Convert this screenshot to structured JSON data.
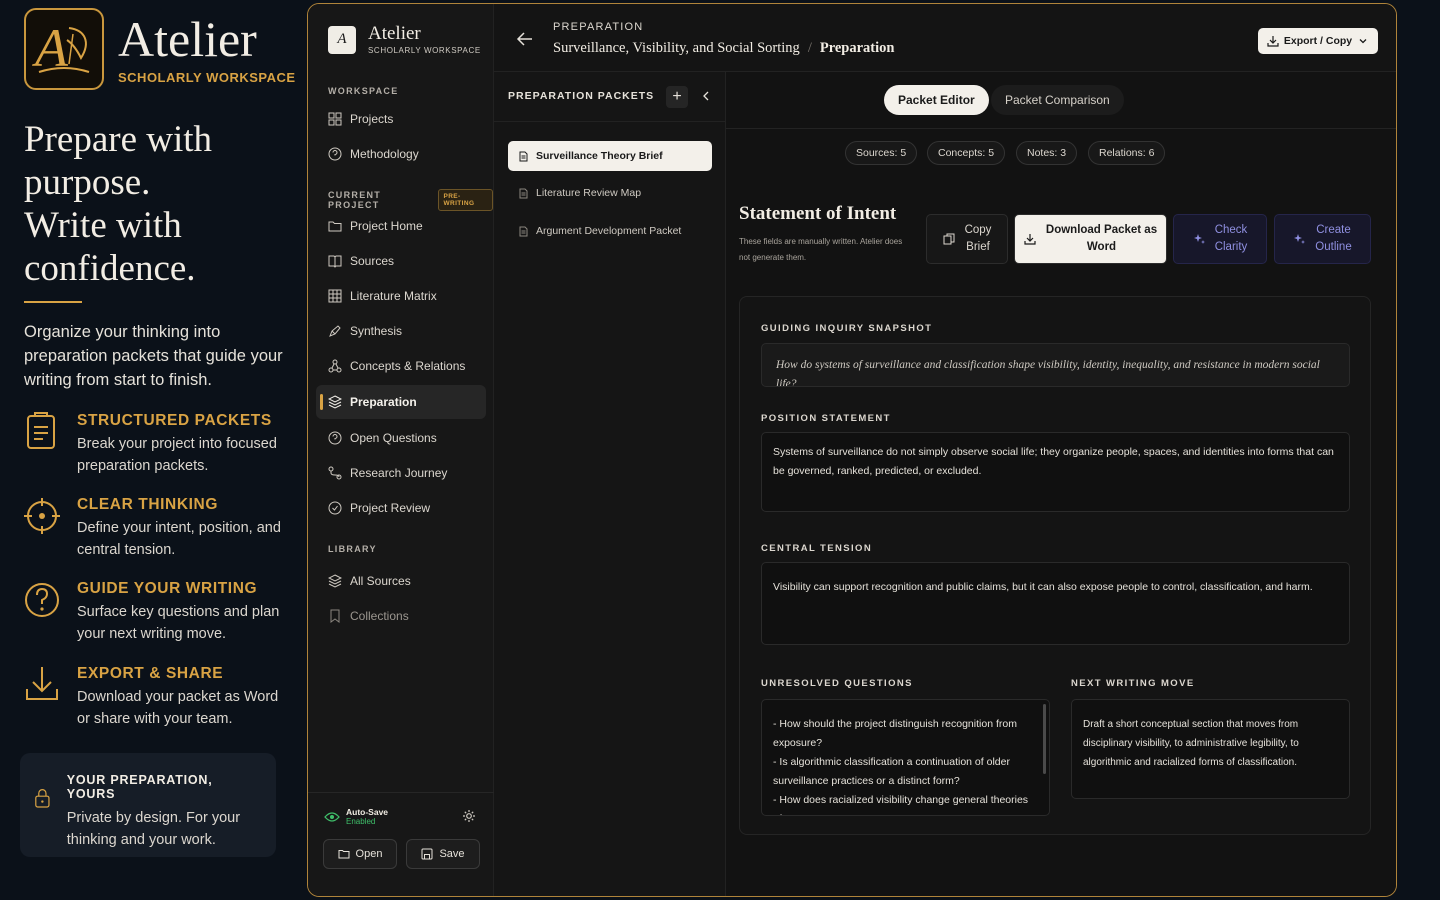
{
  "promo": {
    "brand_name": "Atelier",
    "brand_sub": "SCHOLARLY WORKSPACE",
    "headline": [
      "Prepare with",
      "purpose.",
      "Write with",
      "confidence."
    ],
    "intro": "Organize your thinking into preparation packets that guide your writing from start to finish.",
    "features": [
      {
        "icon": "document-icon",
        "title": "STRUCTURED PACKETS",
        "desc": "Break your project into focused preparation packets."
      },
      {
        "icon": "target-icon",
        "title": "CLEAR THINKING",
        "desc": "Define your intent, position, and central tension."
      },
      {
        "icon": "question-icon",
        "title": "GUIDE YOUR WRITING",
        "desc": "Surface key questions and plan your next writing move."
      },
      {
        "icon": "download-icon",
        "title": "EXPORT & SHARE",
        "desc": "Download your packet as Word or share with your team."
      }
    ],
    "privacy": {
      "icon": "lock-icon",
      "title": "YOUR PREPARATION, YOURS",
      "desc": "Private by design. For your thinking and your work."
    }
  },
  "app": {
    "logo_letter": "A",
    "name": "Atelier",
    "sub": "SCHOLARLY WORKSPACE"
  },
  "nav": {
    "workspace_label": "WORKSPACE",
    "current_project_label": "CURRENT PROJECT",
    "stage_badge": "PRE-WRITING",
    "library_label": "LIBRARY",
    "workspace_items": [
      {
        "icon": "grid-icon",
        "label": "Projects"
      },
      {
        "icon": "help-circle-icon",
        "label": "Methodology"
      }
    ],
    "project_items": [
      {
        "icon": "folder-icon",
        "label": "Project Home"
      },
      {
        "icon": "book-icon",
        "label": "Sources"
      },
      {
        "icon": "table-icon",
        "label": "Literature Matrix"
      },
      {
        "icon": "pen-icon",
        "label": "Synthesis"
      },
      {
        "icon": "network-icon",
        "label": "Concepts & Relations"
      },
      {
        "icon": "layers-icon",
        "label": "Preparation"
      },
      {
        "icon": "help-circle-icon",
        "label": "Open Questions"
      },
      {
        "icon": "route-icon",
        "label": "Research Journey"
      },
      {
        "icon": "check-circle-icon",
        "label": "Project Review"
      }
    ],
    "library_items": [
      {
        "icon": "layers-icon",
        "label": "All Sources"
      },
      {
        "icon": "bookmark-icon",
        "label": "Collections"
      }
    ],
    "autosave_title": "Auto-Save",
    "autosave_status": "Enabled",
    "open_label": "Open",
    "save_label": "Save"
  },
  "header": {
    "section": "PREPARATION",
    "project": "Surveillance, Visibility, and Social Sorting",
    "separator": "/",
    "page": "Preparation",
    "export_label": "Export / Copy"
  },
  "packets": {
    "title": "PREPARATION PACKETS",
    "add": "+",
    "items": [
      "Surveillance Theory Brief",
      "Literature Review Map",
      "Argument Development Packet"
    ]
  },
  "main": {
    "tabs": [
      "Packet Editor",
      "Packet Comparison"
    ],
    "stats": [
      "Sources: 5",
      "Concepts: 5",
      "Notes: 3",
      "Relations: 6"
    ],
    "soi_title": "Statement of Intent",
    "soi_note": "These fields are manually written. Atelier does not generate them.",
    "actions": {
      "copy": [
        "Copy",
        "Brief"
      ],
      "download": [
        "Download Packet as",
        "Word"
      ],
      "clarity": [
        "Check",
        "Clarity"
      ],
      "outline": [
        "Create",
        "Outline"
      ]
    },
    "fields": {
      "guiding_label": "GUIDING INQUIRY SNAPSHOT",
      "guiding_value": "How do systems of surveillance and classification shape visibility, identity, inequality, and resistance in modern social life?",
      "position_label": "POSITION STATEMENT",
      "position_value": "Systems of surveillance do not simply observe social life; they organize people, spaces, and identities into forms that can be governed, ranked, predicted, or excluded.",
      "tension_label": "CENTRAL TENSION",
      "tension_value": "Visibility can support recognition and public claims, but it can also expose people to control, classification, and harm.",
      "questions_label": "UNRESOLVED QUESTIONS",
      "questions_value": [
        "- How should the project distinguish recognition from exposure?",
        "- Is algorithmic classification a continuation of older surveillance practices or a distinct form?",
        "- How does racialized visibility change general theories of"
      ],
      "next_label": "NEXT WRITING MOVE",
      "next_value": "Draft a short conceptual section that moves from disciplinary visibility, to administrative legibility, to algorithmic and racialized forms of classification."
    }
  },
  "colors": {
    "accent": "#d9a344",
    "success": "#3fbf6a",
    "violet": "#8f8fe0"
  }
}
